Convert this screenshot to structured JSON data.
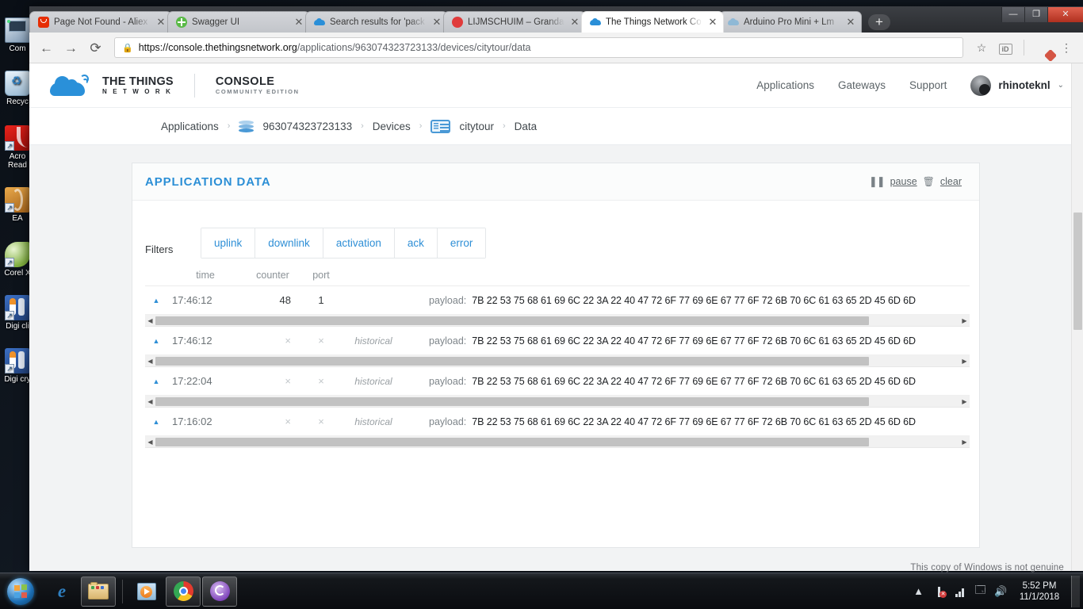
{
  "window": {
    "controls": {
      "minimize": "—",
      "maximize": "❐",
      "close": "✕"
    },
    "newtab_label": "+"
  },
  "browser": {
    "tabs": [
      {
        "title": "Page Not Found - Aliex",
        "favicon": "aliexpress-icon",
        "favicon_color": "#e62e04",
        "active": false
      },
      {
        "title": "Swagger UI",
        "favicon": "swagger-icon",
        "favicon_color": "#5aba47",
        "active": false
      },
      {
        "title": "Search results for 'pack",
        "favicon": "ttn-cloud-icon",
        "favicon_color": "#2a8fd8",
        "active": false
      },
      {
        "title": "LIJMSCHUIM – Grandac",
        "favicon": "red-dot-icon",
        "favicon_color": "#e03b3b",
        "active": false
      },
      {
        "title": "The Things Network Co",
        "favicon": "ttn-cloud-icon",
        "favicon_color": "#2a8fd8",
        "active": true
      },
      {
        "title": "Arduino Pro Mini + Lm",
        "favicon": "ttn-cloud-icon",
        "favicon_color": "#2a8fd8",
        "active": false
      }
    ],
    "close_label": "✕",
    "nav": {
      "back": "←",
      "forward": "→",
      "reload": "⟳"
    },
    "omnibox": {
      "lock_icon": "lock-icon",
      "url_domain": "https://console.thethingsnetwork.org",
      "url_path": "/applications/963074323723133/devices/citytour/data"
    },
    "toolbar_icons": {
      "bookmark": "☆",
      "orcid": "iD",
      "menu": "⋮"
    }
  },
  "ttn": {
    "logo": {
      "line1": "THE THINGS",
      "line2": "N E T W O R K",
      "console_line1": "CONSOLE",
      "console_line2": "COMMUNITY EDITION"
    },
    "nav": [
      "Applications",
      "Gateways",
      "Support"
    ],
    "user": {
      "name": "rhinoteknl",
      "caret": "⌄"
    },
    "breadcrumb": [
      {
        "label": "Applications",
        "icon": null
      },
      {
        "label": "963074323723133",
        "icon": "stack-icon"
      },
      {
        "label": "Devices",
        "icon": null
      },
      {
        "label": "citytour",
        "icon": "device-icon"
      },
      {
        "label": "Data",
        "icon": null
      }
    ],
    "breadcrumb_separator": "›"
  },
  "panel": {
    "title": "APPLICATION DATA",
    "actions": {
      "pause": "pause",
      "clear": "clear",
      "pause_icon": "pause-icon",
      "clear_icon": "trash-icon"
    },
    "filters_label": "Filters",
    "filters": [
      "uplink",
      "downlink",
      "activation",
      "ack",
      "error"
    ],
    "columns": {
      "time": "time",
      "counter": "counter",
      "port": "port"
    },
    "payload_label": "payload:",
    "expand_icon": "▲",
    "rows": [
      {
        "time": "17:46:12",
        "counter": "48",
        "port": "1",
        "historical": "",
        "payload": "7B 22 53 75 68 61 69 6C 22 3A 22 40 47 72 6F 77 69 6E 67 77 6F 72 6B 70 6C 61 63 65 2D 45 6D 6D",
        "scroll_thumb_pct": 92
      },
      {
        "time": "17:46:12",
        "counter": "×",
        "port": "×",
        "historical": "historical",
        "payload": "7B 22 53 75 68 61 69 6C 22 3A 22 40 47 72 6F 77 69 6E 67 77 6F 72 6B 70 6C 61 63 65 2D 45 6D 6D",
        "scroll_thumb_pct": 92
      },
      {
        "time": "17:22:04",
        "counter": "×",
        "port": "×",
        "historical": "historical",
        "payload": "7B 22 53 75 68 61 69 6C 22 3A 22 40 47 72 6F 77 69 6E 67 77 6F 72 6B 70 6C 61 63 65 2D 45 6D 6D",
        "scroll_thumb_pct": 92
      },
      {
        "time": "17:16:02",
        "counter": "×",
        "port": "×",
        "historical": "historical",
        "payload": "7B 22 53 75 68 61 69 6C 22 3A 22 40 47 72 6F 77 69 6E 67 77 6F 72 6B 70 6C 61 63 65 2D 45 6D 6D",
        "scroll_thumb_pct": 92
      }
    ],
    "scroll_left_arrow": "◀",
    "scroll_right_arrow": "▶"
  },
  "desktop": {
    "icons": [
      {
        "label": "Com",
        "name": "computer-icon",
        "shortcut": false,
        "color": "#9fb7cd"
      },
      {
        "label": "Recyc",
        "name": "recycle-bin-icon",
        "shortcut": false,
        "color": "#bcd4e6"
      },
      {
        "label": "Acro Read",
        "name": "acrobat-reader-icon",
        "shortcut": true,
        "color": "#cc0000"
      },
      {
        "label": "EA",
        "name": "ea-icon",
        "shortcut": true,
        "color": "#c8872f"
      },
      {
        "label": "Corel X",
        "name": "corel-icon",
        "shortcut": true,
        "color": "#8fbf5a"
      },
      {
        "label": "Digi cli",
        "name": "digi-client-icon",
        "shortcut": true,
        "color": "#2f5fa8"
      },
      {
        "label": "Digi cry",
        "name": "digi-crypto-icon",
        "shortcut": true,
        "color": "#2f5fa8"
      }
    ]
  },
  "taskbar": {
    "start_label": "start-orb",
    "apps": [
      {
        "name": "internet-explorer-icon",
        "open": false
      },
      {
        "name": "file-explorer-icon",
        "open": true
      },
      {
        "name": "media-player-icon",
        "open": false
      },
      {
        "name": "google-chrome-icon",
        "open": true
      },
      {
        "name": "bittorrent-icon",
        "open": true
      }
    ],
    "tray": {
      "show_hidden": "▲",
      "network_icon": "network-error-icon",
      "signal_icon": "signal-icon",
      "action_icon": "action-center-icon",
      "volume_icon": "volume-icon",
      "time": "5:52 PM",
      "date": "11/1/2018"
    },
    "watermark": "This copy of Windows is not genuine"
  }
}
